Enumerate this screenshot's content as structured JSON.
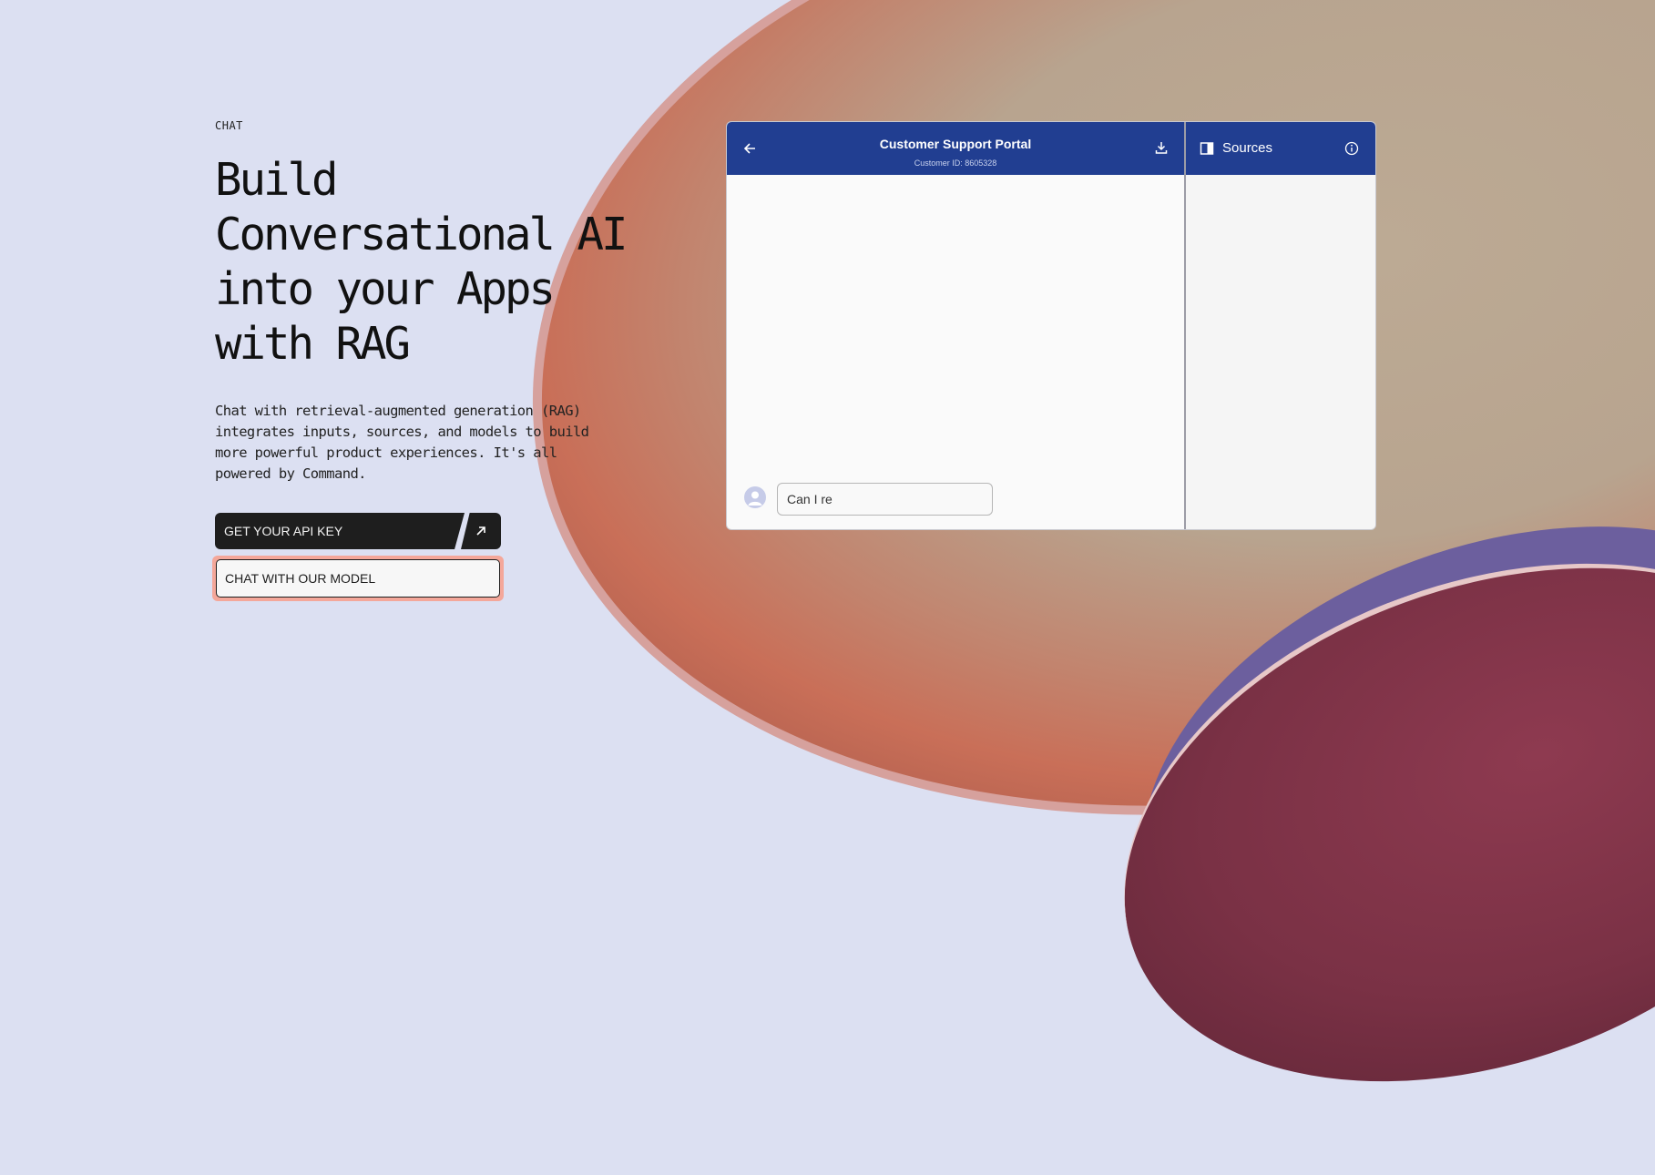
{
  "hero": {
    "eyebrow": "CHAT",
    "headline_lines": [
      "Build",
      "Conversational AI",
      "into your Apps",
      "with RAG"
    ],
    "description": "Chat with retrieval-augmented generation (RAG) integrates inputs, sources, and models to build more powerful product experiences. It's all powered by Command.",
    "primary_button": "GET YOUR API KEY",
    "primary_button_icon": "arrow-up-right-icon",
    "secondary_button": "CHAT WITH OUR MODEL"
  },
  "demo": {
    "chat_header": {
      "back_icon": "arrow-left-icon",
      "title": "Customer Support Portal",
      "subtitle": "Customer ID: 8605328",
      "download_icon": "download-icon"
    },
    "sources_header": {
      "panel_icon": "sidebar-panel-icon",
      "label": "Sources",
      "info_icon": "info-icon"
    },
    "composer": {
      "avatar_icon": "user-avatar-icon",
      "input_value": "Can I re"
    }
  },
  "colors": {
    "page_background": "#dce0f2",
    "header_blue": "#213e91",
    "button_dark": "#1e1e1e",
    "focus_ring": "#f4a79a"
  }
}
